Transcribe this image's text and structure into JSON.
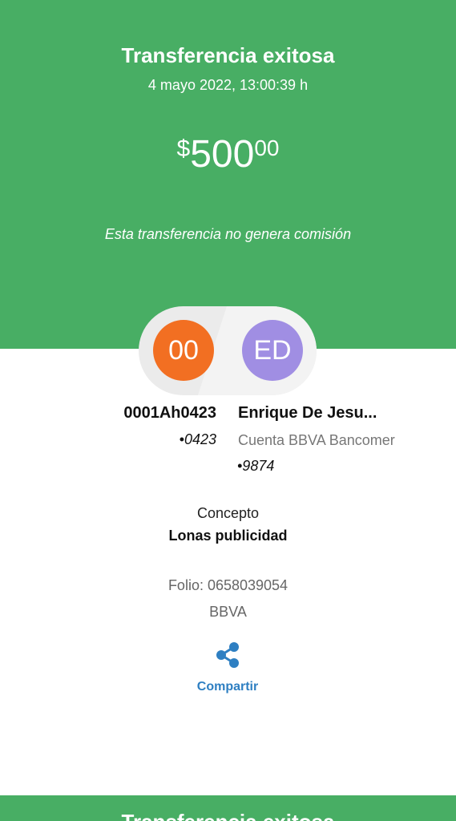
{
  "header": {
    "title": "Transferencia exitosa",
    "datetime": "4 mayo 2022, 13:00:39 h",
    "amount": {
      "currency": "$",
      "integer": "500",
      "decimals": "00"
    },
    "commission_note": "Esta transferencia no genera comisión"
  },
  "from": {
    "initials": "00",
    "name": "0001Ah0423",
    "account": "•0423",
    "color": "#f26f22"
  },
  "to": {
    "initials": "ED",
    "name": "Enrique De Jesu...",
    "bank": "Cuenta BBVA Bancomer",
    "account": "•9874",
    "color": "#a08ee3"
  },
  "details": {
    "concept_label": "Concepto",
    "concept_value": "Lonas publicidad",
    "folio": "Folio: 0658039054",
    "bank": "BBVA"
  },
  "actions": {
    "share_label": "Compartir",
    "share_icon": "share-icon"
  },
  "next_card": {
    "title": "Transferencia exitosa"
  },
  "colors": {
    "green": "#48ae64",
    "link_blue": "#2e7fc2"
  }
}
